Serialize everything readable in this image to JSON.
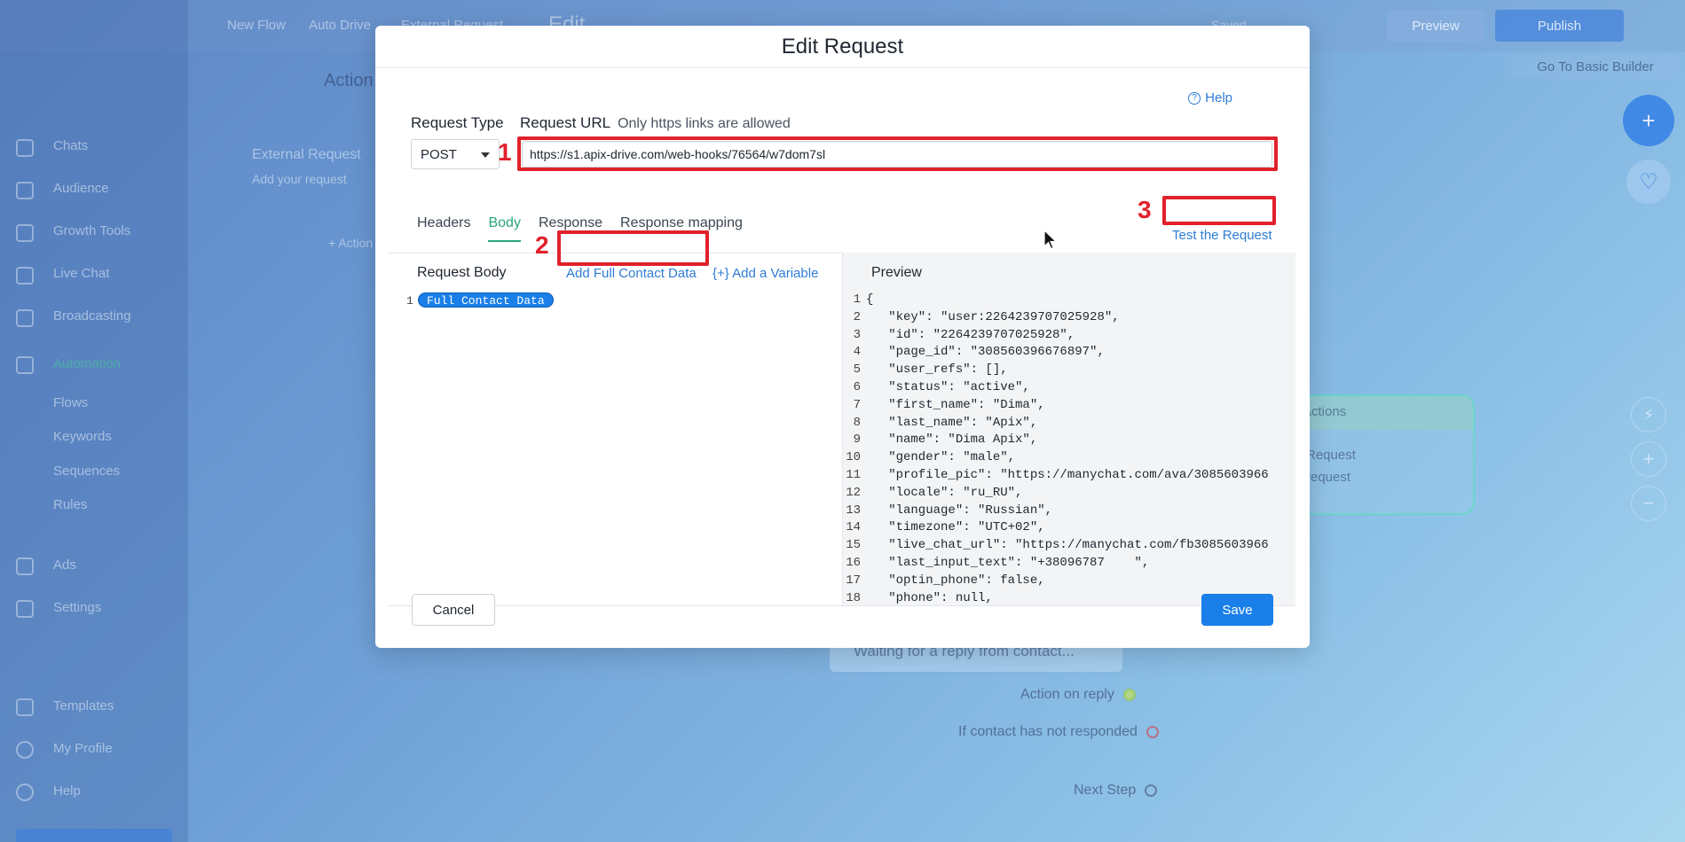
{
  "background": {
    "breadcrumb": [
      "New Flow",
      "Auto Drive",
      "External Request"
    ],
    "page_heading": "Edit",
    "saved_label": "Saved",
    "preview_button": "Preview",
    "publish_button": "Publish",
    "basic_builder_link": "Go To Basic Builder",
    "action_label": "Action",
    "external_request_title": "External Request",
    "external_request_sub": "Add your request",
    "add_action_label": "+ Action",
    "sidebar_items": [
      "Chats",
      "Audience",
      "Growth Tools",
      "Live Chat",
      "Broadcasting",
      "Automation",
      "Flows",
      "Keywords",
      "Sequences",
      "Rules",
      "Ads",
      "Settings",
      "Templates",
      "My Profile",
      "Help"
    ],
    "card_header": "Actions",
    "card_line1": "Request",
    "card_line2": "request",
    "waiting_text": "Waiting for a reply from contact...",
    "action_on_reply": "Action on reply",
    "not_responded": "If contact has not responded",
    "next_step": "Next Step"
  },
  "modal": {
    "title": "Edit Request",
    "help_label": "Help",
    "request_type_label": "Request Type",
    "request_type_value": "POST",
    "request_url_label": "Request URL",
    "request_url_hint": "Only https links are allowed",
    "request_url_value": "https://s1.apix-drive.com/web-hooks/76564/w7dom7sl",
    "tabs": [
      {
        "label": "Headers",
        "active": false
      },
      {
        "label": "Body",
        "active": true
      },
      {
        "label": "Response",
        "active": false
      },
      {
        "label": "Response mapping",
        "active": false
      }
    ],
    "test_request_label": "Test the Request",
    "request_body_label": "Request Body",
    "add_full_contact_label": "Add Full Contact Data",
    "add_variable_label": "{+} Add a Variable",
    "body_line_number": "1",
    "body_chip": "Full Contact Data",
    "preview_label": "Preview",
    "preview_lines": [
      {
        "n": "1",
        "t": "{"
      },
      {
        "n": "2",
        "t": "   \"key\": \"user:2264239707025928\","
      },
      {
        "n": "3",
        "t": "   \"id\": \"2264239707025928\","
      },
      {
        "n": "4",
        "t": "   \"page_id\": \"308560396676897\","
      },
      {
        "n": "5",
        "t": "   \"user_refs\": [],"
      },
      {
        "n": "6",
        "t": "   \"status\": \"active\","
      },
      {
        "n": "7",
        "t": "   \"first_name\": \"Dima\","
      },
      {
        "n": "8",
        "t": "   \"last_name\": \"Apix\","
      },
      {
        "n": "9",
        "t": "   \"name\": \"Dima Apix\","
      },
      {
        "n": "10",
        "t": "   \"gender\": \"male\","
      },
      {
        "n": "11",
        "t": "   \"profile_pic\": \"https://manychat.com/ava/3085603966"
      },
      {
        "n": "12",
        "t": "   \"locale\": \"ru_RU\","
      },
      {
        "n": "13",
        "t": "   \"language\": \"Russian\","
      },
      {
        "n": "14",
        "t": "   \"timezone\": \"UTC+02\","
      },
      {
        "n": "15",
        "t": "   \"live_chat_url\": \"https://manychat.com/fb3085603966"
      },
      {
        "n": "16",
        "t": "   \"last_input_text\": \"+38096787    \","
      },
      {
        "n": "17",
        "t": "   \"optin_phone\": false,"
      },
      {
        "n": "18",
        "t": "   \"phone\": null,"
      }
    ],
    "cancel_label": "Cancel",
    "save_label": "Save"
  },
  "annotations": {
    "one": "1",
    "two": "2",
    "three": "3",
    "color": "#e1212b"
  },
  "colors": {
    "accent_blue": "#1a7fe8",
    "tab_active_green": "#2aa47d",
    "link_blue": "#2e7cd6"
  }
}
